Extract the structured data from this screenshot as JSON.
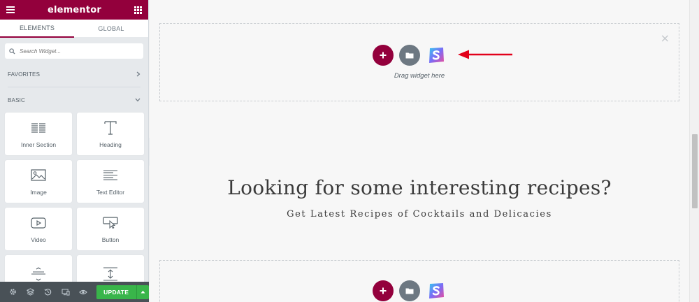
{
  "header": {
    "logo": "elementor"
  },
  "tabs": [
    {
      "label": "ELEMENTS",
      "active": true
    },
    {
      "label": "GLOBAL",
      "active": false
    }
  ],
  "search": {
    "placeholder": "Search Widget..."
  },
  "categories": {
    "favorites": "FAVORITES",
    "basic": "BASIC"
  },
  "widgets": [
    {
      "label": "Inner Section",
      "icon": "inner-section-icon"
    },
    {
      "label": "Heading",
      "icon": "heading-icon"
    },
    {
      "label": "Image",
      "icon": "image-icon"
    },
    {
      "label": "Text Editor",
      "icon": "text-editor-icon"
    },
    {
      "label": "Video",
      "icon": "video-icon"
    },
    {
      "label": "Button",
      "icon": "button-icon"
    },
    {
      "label": "",
      "icon": "divider-icon"
    },
    {
      "label": "",
      "icon": "spacer-icon"
    }
  ],
  "footer": {
    "update_label": "UPDATE"
  },
  "canvas": {
    "drag_text": "Drag widget here",
    "heading": "Looking for some interesting recipes?",
    "subheading": "Get Latest Recipes of Cocktails and Delicacies"
  },
  "colors": {
    "brand": "#93003c",
    "update": "#39b54a",
    "arrow": "#e2001a"
  }
}
